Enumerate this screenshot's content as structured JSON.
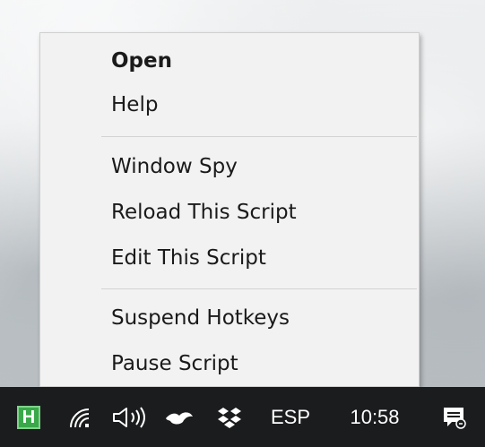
{
  "menu": {
    "items": [
      {
        "label": "Open",
        "bold": true
      },
      {
        "label": "Help"
      },
      {
        "label": "Window Spy"
      },
      {
        "label": "Reload This Script"
      },
      {
        "label": "Edit This Script"
      },
      {
        "label": "Suspend Hotkeys"
      },
      {
        "label": "Pause Script"
      }
    ]
  },
  "taskbar": {
    "app_icon_letter": "H",
    "language": "ESP",
    "clock": "10:58",
    "icons": [
      "autohotkey-icon",
      "wifi-icon",
      "volume-icon",
      "onedrive-icon",
      "dropbox-icon",
      "notifications-icon"
    ]
  }
}
